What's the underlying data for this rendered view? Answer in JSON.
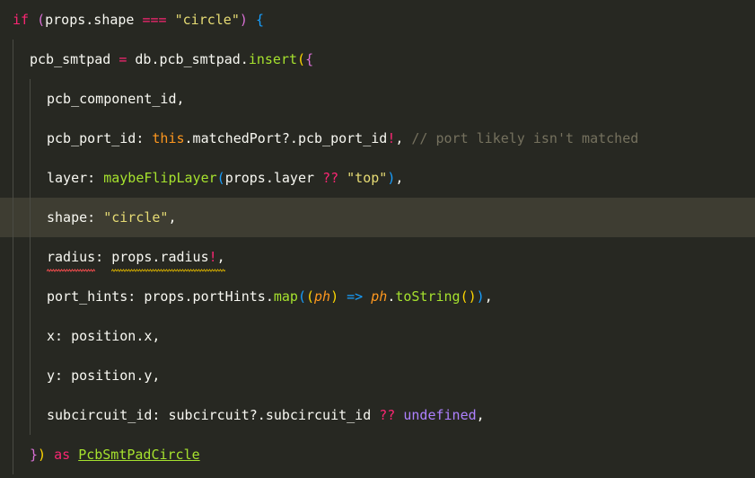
{
  "editor": {
    "current_line_index": 5,
    "lines": [
      {
        "indent": 0,
        "tokens": [
          {
            "t": "if",
            "c": "kw"
          },
          {
            "t": " ",
            "c": ""
          },
          {
            "t": "(",
            "c": "b2"
          },
          {
            "t": "props.shape ",
            "c": ""
          },
          {
            "t": "===",
            "c": "kw"
          },
          {
            "t": " ",
            "c": ""
          },
          {
            "t": "\"circle\"",
            "c": "str"
          },
          {
            "t": ")",
            "c": "b2"
          },
          {
            "t": " ",
            "c": ""
          },
          {
            "t": "{",
            "c": "b3"
          }
        ]
      },
      {
        "indent": 1,
        "tokens": [
          {
            "t": "pcb_smtpad ",
            "c": ""
          },
          {
            "t": "=",
            "c": "kw"
          },
          {
            "t": " db.pcb_smtpad.",
            "c": ""
          },
          {
            "t": "insert",
            "c": "fn"
          },
          {
            "t": "(",
            "c": "b1"
          },
          {
            "t": "{",
            "c": "b2"
          }
        ]
      },
      {
        "indent": 2,
        "tokens": [
          {
            "t": "pcb_component_id,",
            "c": ""
          }
        ]
      },
      {
        "indent": 2,
        "tokens": [
          {
            "t": "pcb_port_id: ",
            "c": ""
          },
          {
            "t": "this",
            "c": "this"
          },
          {
            "t": ".matchedPort?.pcb_port_id",
            "c": ""
          },
          {
            "t": "!",
            "c": "kw"
          },
          {
            "t": ", ",
            "c": ""
          },
          {
            "t": "// port likely isn't matched",
            "c": "cmt"
          }
        ]
      },
      {
        "indent": 2,
        "tokens": [
          {
            "t": "layer: ",
            "c": ""
          },
          {
            "t": "maybeFlipLayer",
            "c": "fn"
          },
          {
            "t": "(",
            "c": "b3"
          },
          {
            "t": "props.layer ",
            "c": ""
          },
          {
            "t": "??",
            "c": "kw"
          },
          {
            "t": " ",
            "c": ""
          },
          {
            "t": "\"top\"",
            "c": "str"
          },
          {
            "t": ")",
            "c": "b3"
          },
          {
            "t": ",",
            "c": ""
          }
        ]
      },
      {
        "indent": 2,
        "tokens": [
          {
            "t": "shape: ",
            "c": ""
          },
          {
            "t": "\"circle\"",
            "c": "str"
          },
          {
            "t": ",",
            "c": ""
          }
        ]
      },
      {
        "indent": 2,
        "tokens": [
          {
            "t": "radius: props.radius",
            "c": ""
          },
          {
            "t": "!",
            "c": "kw"
          },
          {
            "t": ",",
            "c": ""
          }
        ]
      },
      {
        "indent": 2,
        "tokens": [
          {
            "t": "port_hints: props.portHints.",
            "c": ""
          },
          {
            "t": "map",
            "c": "fn"
          },
          {
            "t": "(",
            "c": "b3"
          },
          {
            "t": "(",
            "c": "b1"
          },
          {
            "t": "ph",
            "c": "param"
          },
          {
            "t": ")",
            "c": "b1"
          },
          {
            "t": " ",
            "c": ""
          },
          {
            "t": "=>",
            "c": "b3"
          },
          {
            "t": " ",
            "c": ""
          },
          {
            "t": "ph",
            "c": "param"
          },
          {
            "t": ".",
            "c": ""
          },
          {
            "t": "toString",
            "c": "fn"
          },
          {
            "t": "()",
            "c": "b1"
          },
          {
            "t": ")",
            "c": "b3"
          },
          {
            "t": ",",
            "c": ""
          }
        ]
      },
      {
        "indent": 2,
        "tokens": [
          {
            "t": "x: position.x,",
            "c": ""
          }
        ]
      },
      {
        "indent": 2,
        "tokens": [
          {
            "t": "y: position.y,",
            "c": ""
          }
        ]
      },
      {
        "indent": 2,
        "tokens": [
          {
            "t": "subcircuit_id: subcircuit?.subcircuit_id ",
            "c": ""
          },
          {
            "t": "??",
            "c": "kw"
          },
          {
            "t": " ",
            "c": ""
          },
          {
            "t": "undefined",
            "c": "const"
          },
          {
            "t": ",",
            "c": ""
          }
        ]
      },
      {
        "indent": 1,
        "tokens": [
          {
            "t": "}",
            "c": "b2"
          },
          {
            "t": ")",
            "c": "b1"
          },
          {
            "t": " ",
            "c": ""
          },
          {
            "t": "as",
            "c": "kw"
          },
          {
            "t": " ",
            "c": ""
          },
          {
            "t": "PcbSmtPadCircle",
            "c": "type-ul"
          }
        ]
      }
    ]
  },
  "colors": {
    "background": "#272822",
    "current_line": "#3e3d32",
    "keyword": "#f92672",
    "string": "#e6db74",
    "function": "#a6e22e",
    "comment": "#75715e",
    "constant": "#ae81ff",
    "error_squiggle": "#f14c4c",
    "warning_squiggle": "#cca700"
  }
}
